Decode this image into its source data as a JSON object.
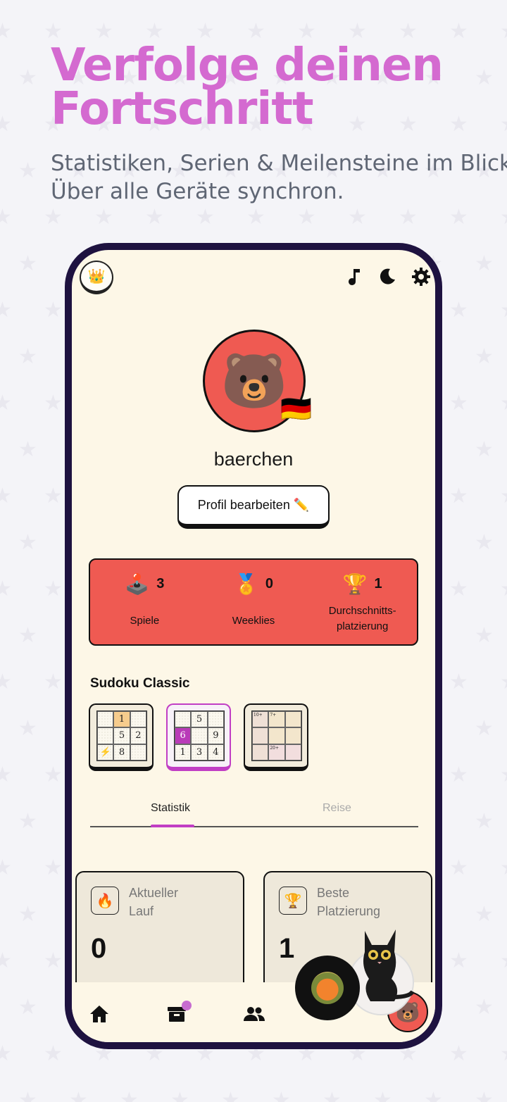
{
  "promo": {
    "headline_line1": "Verfolge deinen",
    "headline_line2": "Fortschritt",
    "subline_line1": "Statistiken, Serien & Meilensteine im Blick.",
    "subline_line2": "Über alle Geräte synchron."
  },
  "top_bar": {
    "left_badge_icon": "crown-icon",
    "right_icons": [
      "music-note-icon",
      "moon-icon",
      "gear-icon"
    ]
  },
  "profile": {
    "avatar_emoji": "🐻",
    "flag_emoji": "🇩🇪",
    "username": "baerchen",
    "edit_button": "Profil bearbeiten ✏️"
  },
  "stats": [
    {
      "emoji": "🕹️",
      "value": "3",
      "label": "Spiele"
    },
    {
      "emoji": "🏅",
      "value": "0",
      "label": "Weeklies"
    },
    {
      "emoji": "🏆",
      "value": "1",
      "label_line1": "Durchschnitts-",
      "label_line2": "platzierung"
    }
  ],
  "game_section": {
    "title": "Sudoku Classic",
    "mode1_cells": [
      "",
      "1",
      "",
      "",
      "5",
      "2",
      "⚡",
      "8",
      ""
    ],
    "mode2_cells": [
      "",
      "5",
      "",
      "6",
      "",
      "9",
      "1",
      "3",
      "4"
    ],
    "mode3_labels": [
      "10+",
      "7+",
      "20+"
    ]
  },
  "tabs": {
    "tab1": "Statistik",
    "tab2": "Reise"
  },
  "tiles": [
    {
      "emoji": "🔥",
      "title_line1": "Aktueller",
      "title_line2": "Lauf",
      "value": "0"
    },
    {
      "emoji": "🏆",
      "title_line1": "Beste",
      "title_line2": "Platzierung",
      "value": "1"
    }
  ],
  "bottom_nav": {
    "icons": [
      "home-icon",
      "inbox-icon",
      "friends-icon"
    ],
    "avatar_emoji": "🐻"
  },
  "colors": {
    "headline": "#d46ad0",
    "accent_red": "#ef5a52",
    "accent_purple": "#c13ec4",
    "frame": "#1e1240",
    "screen_bg": "#fdf7e7"
  }
}
